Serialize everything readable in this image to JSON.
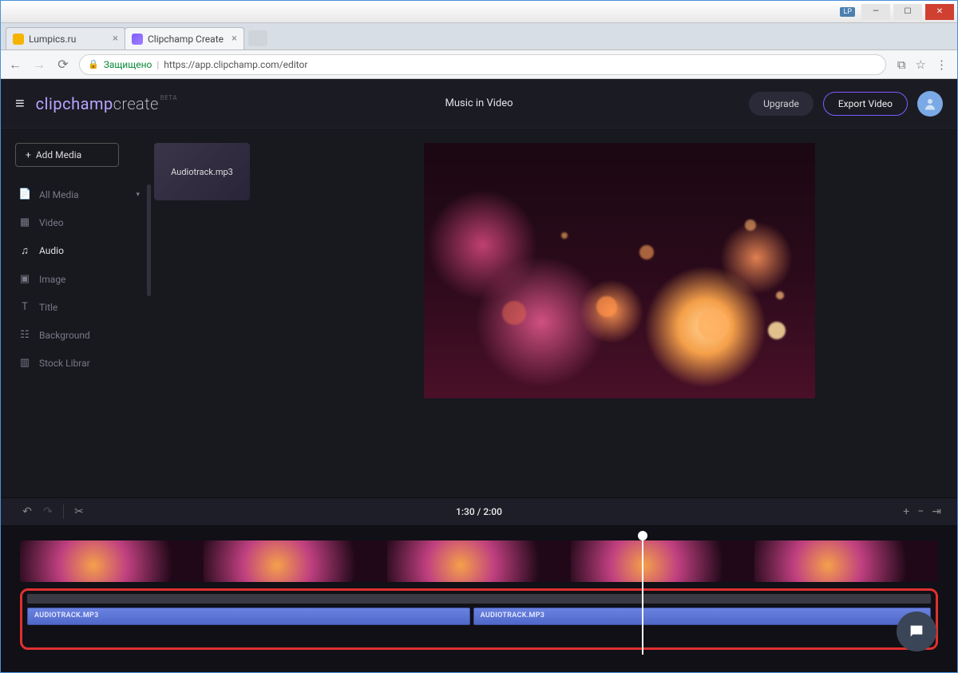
{
  "titlebar": {
    "profile_badge": "LP"
  },
  "tabs": [
    {
      "label": "Lumpics.ru",
      "active": false
    },
    {
      "label": "Clipchamp Create",
      "active": true
    }
  ],
  "addressbar": {
    "secure_label": "Защищено",
    "url": "https://app.clipchamp.com/editor"
  },
  "header": {
    "logo_part1": "clipchamp",
    "logo_part2": "create",
    "logo_suffix": "BETA",
    "project_title": "Music in Video",
    "upgrade_label": "Upgrade",
    "export_label": "Export Video"
  },
  "sidebar": {
    "add_media_label": "Add Media",
    "items": [
      {
        "icon": "file",
        "label": "All Media"
      },
      {
        "icon": "video",
        "label": "Video"
      },
      {
        "icon": "audio",
        "label": "Audio",
        "selected": true
      },
      {
        "icon": "image",
        "label": "Image"
      },
      {
        "icon": "title",
        "label": "Title"
      },
      {
        "icon": "background",
        "label": "Background"
      },
      {
        "icon": "stock",
        "label": "Stock Librar"
      }
    ]
  },
  "media": {
    "card_label": "Audiotrack.mp3"
  },
  "timeline": {
    "time_display": "1:30 / 2:00",
    "audio_clip1_label": "AUDIOTRACK.MP3",
    "audio_clip2_label": "AUDIOTRACK.MP3"
  }
}
